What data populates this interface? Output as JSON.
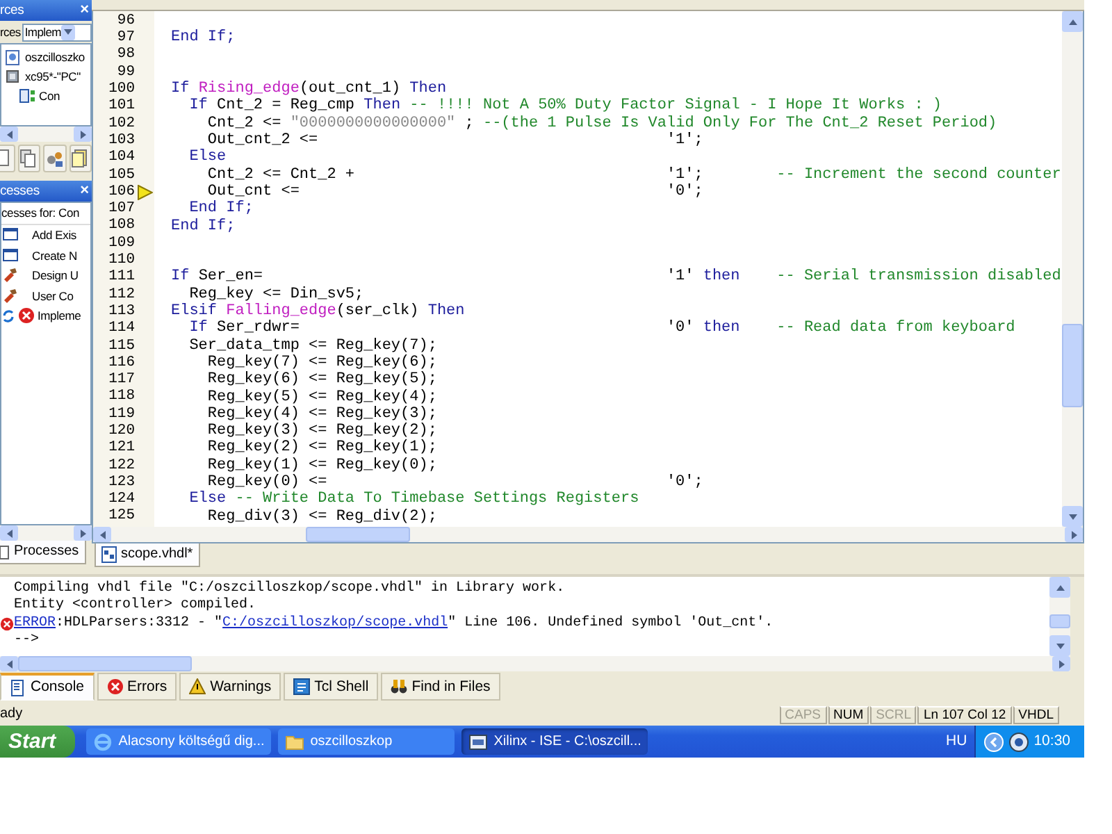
{
  "sources_panel": {
    "title": "rces",
    "close": "×",
    "filter_label": "rces",
    "filter_value": "Implem",
    "tree": [
      {
        "label": "oszcilloszko",
        "kind": "project"
      },
      {
        "label": "xc95*-\"PC\"",
        "kind": "device",
        "children": [
          {
            "label": "Con",
            "kind": "module"
          }
        ]
      }
    ]
  },
  "processes_panel": {
    "title": "cesses",
    "close": "×",
    "header": "cesses for: Con",
    "items": [
      {
        "label": "Add Exis",
        "kind": "window"
      },
      {
        "label": "Create N",
        "kind": "window"
      },
      {
        "label": "Design U",
        "kind": "tools"
      },
      {
        "label": "User Co",
        "kind": "tools"
      },
      {
        "label": "Impleme",
        "kind": "error"
      }
    ],
    "tab": "Processes"
  },
  "editor": {
    "tab": "scope.vhdl*",
    "lines": [
      {
        "number": "96",
        "marker": false
      },
      {
        "number": "97",
        "marker": false,
        "code": [
          {
            "kind": "kw",
            "text": "End If;"
          }
        ]
      },
      {
        "number": "98",
        "marker": false
      },
      {
        "number": "99",
        "marker": false
      },
      {
        "number": "100",
        "marker": false,
        "code": [
          {
            "kind": "kw",
            "text": "If "
          },
          {
            "kind": "fn",
            "text": "Rising_edge"
          },
          {
            "kind": "tx",
            "text": "(out_cnt_1) "
          },
          {
            "kind": "kw",
            "text": "Then"
          }
        ]
      },
      {
        "number": "101",
        "marker": false,
        "code": [
          {
            "kind": "kw",
            "text": "  If "
          },
          {
            "kind": "tx",
            "text": "Cnt_2 = Reg_cmp "
          },
          {
            "kind": "kw",
            "text": "Then "
          },
          {
            "kind": "cm",
            "text": "-- !!!! Not A 50% Duty Factor Signal - I Hope It Works : )"
          }
        ]
      },
      {
        "number": "102",
        "marker": false,
        "code": [
          {
            "kind": "tx",
            "text": "    Cnt_2 <= "
          },
          {
            "kind": "str",
            "text": "\"0000000000000000\""
          },
          {
            "kind": "tx",
            "text": " ; "
          },
          {
            "kind": "cm",
            "text": "--(the 1 Pulse Is Valid Only For The Cnt_2 Reset Period)"
          }
        ]
      },
      {
        "number": "103",
        "marker": false,
        "code": [
          {
            "kind": "tx",
            "text": "    Out_cnt_2 <="
          }
        ],
        "value": [
          {
            "kind": "tx",
            "text": "'1';"
          }
        ]
      },
      {
        "number": "104",
        "marker": false,
        "code": [
          {
            "kind": "kw",
            "text": "  Else"
          }
        ]
      },
      {
        "number": "105",
        "marker": false,
        "code": [
          {
            "kind": "tx",
            "text": "    Cnt_2 <= Cnt_2 +"
          }
        ],
        "value": [
          {
            "kind": "tx",
            "text": "'1';"
          }
        ],
        "comment": "-- Increment the second counter"
      },
      {
        "number": "106",
        "marker": true,
        "code": [
          {
            "kind": "tx",
            "text": "    Out_cnt <="
          }
        ],
        "value": [
          {
            "kind": "tx",
            "text": "'0';"
          }
        ]
      },
      {
        "number": "107",
        "marker": false,
        "code": [
          {
            "kind": "kw",
            "text": "  End If;"
          }
        ]
      },
      {
        "number": "108",
        "marker": false,
        "code": [
          {
            "kind": "kw",
            "text": "End If;"
          }
        ]
      },
      {
        "number": "109",
        "marker": false
      },
      {
        "number": "110",
        "marker": false
      },
      {
        "number": "111",
        "marker": false,
        "code": [
          {
            "kind": "kw",
            "text": "If "
          },
          {
            "kind": "tx",
            "text": "Ser_en="
          }
        ],
        "value": [
          {
            "kind": "tx",
            "text": "'1' "
          },
          {
            "kind": "kw",
            "text": "then"
          }
        ],
        "comment": "-- Serial transmission disabled"
      },
      {
        "number": "112",
        "marker": false,
        "code": [
          {
            "kind": "tx",
            "text": "  Reg_key <= Din_sv5;"
          }
        ]
      },
      {
        "number": "113",
        "marker": false,
        "code": [
          {
            "kind": "kw",
            "text": "Elsif "
          },
          {
            "kind": "fn",
            "text": "Falling_edge"
          },
          {
            "kind": "tx",
            "text": "(ser_clk) "
          },
          {
            "kind": "kw",
            "text": "Then"
          }
        ]
      },
      {
        "number": "114",
        "marker": false,
        "code": [
          {
            "kind": "kw",
            "text": "  If "
          },
          {
            "kind": "tx",
            "text": "Ser_rdwr="
          }
        ],
        "value": [
          {
            "kind": "tx",
            "text": "'0' "
          },
          {
            "kind": "kw",
            "text": "then"
          }
        ],
        "comment": "-- Read data from keyboard"
      },
      {
        "number": "115",
        "marker": false,
        "code": [
          {
            "kind": "tx",
            "text": "  Ser_data_tmp <= Reg_key(7);"
          }
        ]
      },
      {
        "number": "116",
        "marker": false,
        "code": [
          {
            "kind": "tx",
            "text": "    Reg_key(7) <= Reg_key(6);"
          }
        ]
      },
      {
        "number": "117",
        "marker": false,
        "code": [
          {
            "kind": "tx",
            "text": "    Reg_key(6) <= Reg_key(5);"
          }
        ]
      },
      {
        "number": "118",
        "marker": false,
        "code": [
          {
            "kind": "tx",
            "text": "    Reg_key(5) <= Reg_key(4);"
          }
        ]
      },
      {
        "number": "119",
        "marker": false,
        "code": [
          {
            "kind": "tx",
            "text": "    Reg_key(4) <= Reg_key(3);"
          }
        ]
      },
      {
        "number": "120",
        "marker": false,
        "code": [
          {
            "kind": "tx",
            "text": "    Reg_key(3) <= Reg_key(2);"
          }
        ]
      },
      {
        "number": "121",
        "marker": false,
        "code": [
          {
            "kind": "tx",
            "text": "    Reg_key(2) <= Reg_key(1);"
          }
        ]
      },
      {
        "number": "122",
        "marker": false,
        "code": [
          {
            "kind": "tx",
            "text": "    Reg_key(1) <= Reg_key(0);"
          }
        ]
      },
      {
        "number": "123",
        "marker": false,
        "code": [
          {
            "kind": "tx",
            "text": "    Reg_key(0) <="
          }
        ],
        "value": [
          {
            "kind": "tx",
            "text": "'0';"
          }
        ]
      },
      {
        "number": "124",
        "marker": false,
        "code": [
          {
            "kind": "kw",
            "text": "  Else "
          },
          {
            "kind": "cm",
            "text": "-- Write Data To Timebase Settings Registers"
          }
        ]
      },
      {
        "number": "125",
        "marker": false,
        "code": [
          {
            "kind": "tx",
            "text": "    Reg_div(3) <= Reg_div(2);"
          }
        ]
      }
    ]
  },
  "console": {
    "lines": [
      {
        "kind": "info",
        "text": "Compiling vhdl file \"C:/oszcilloszkop/scope.vhdl\" in Library work."
      },
      {
        "kind": "info",
        "text": "Entity <controller> compiled."
      },
      {
        "kind": "error",
        "parts": [
          {
            "kind": "link",
            "text": "ERROR"
          },
          {
            "kind": "text",
            "text": ":HDLParsers:3312 - \""
          },
          {
            "kind": "link",
            "text": "C:/oszcilloszkop/scope.vhdl"
          },
          {
            "kind": "text",
            "text": "\" Line 106. Undefined symbol 'Out_cnt'."
          }
        ]
      },
      {
        "kind": "info",
        "text": "-->"
      }
    ],
    "tabs": [
      {
        "label": "Console",
        "kind": "console",
        "selected": true
      },
      {
        "label": "Errors",
        "kind": "errors",
        "selected": false
      },
      {
        "label": "Warnings",
        "kind": "warnings",
        "selected": false
      },
      {
        "label": "Tcl Shell",
        "kind": "tcl",
        "selected": false
      },
      {
        "label": "Find in Files",
        "kind": "find",
        "selected": false
      }
    ]
  },
  "status_bar": {
    "message": "ady",
    "indicators": [
      {
        "label": "CAPS",
        "on": false
      },
      {
        "label": "NUM",
        "on": true
      },
      {
        "label": "SCRL",
        "on": false
      }
    ],
    "position": "Ln 107 Col 12",
    "language": "VHDL"
  },
  "taskbar": {
    "start": "Start",
    "tasks": [
      {
        "label": "Alacsony költségű dig...",
        "kind": "browser",
        "selected": false
      },
      {
        "label": "oszcilloszkop",
        "kind": "folder",
        "selected": false
      },
      {
        "label": "Xilinx - ISE - C:\\oszcill...",
        "kind": "app",
        "selected": true
      }
    ],
    "language": "HU",
    "clock": "10:30"
  }
}
